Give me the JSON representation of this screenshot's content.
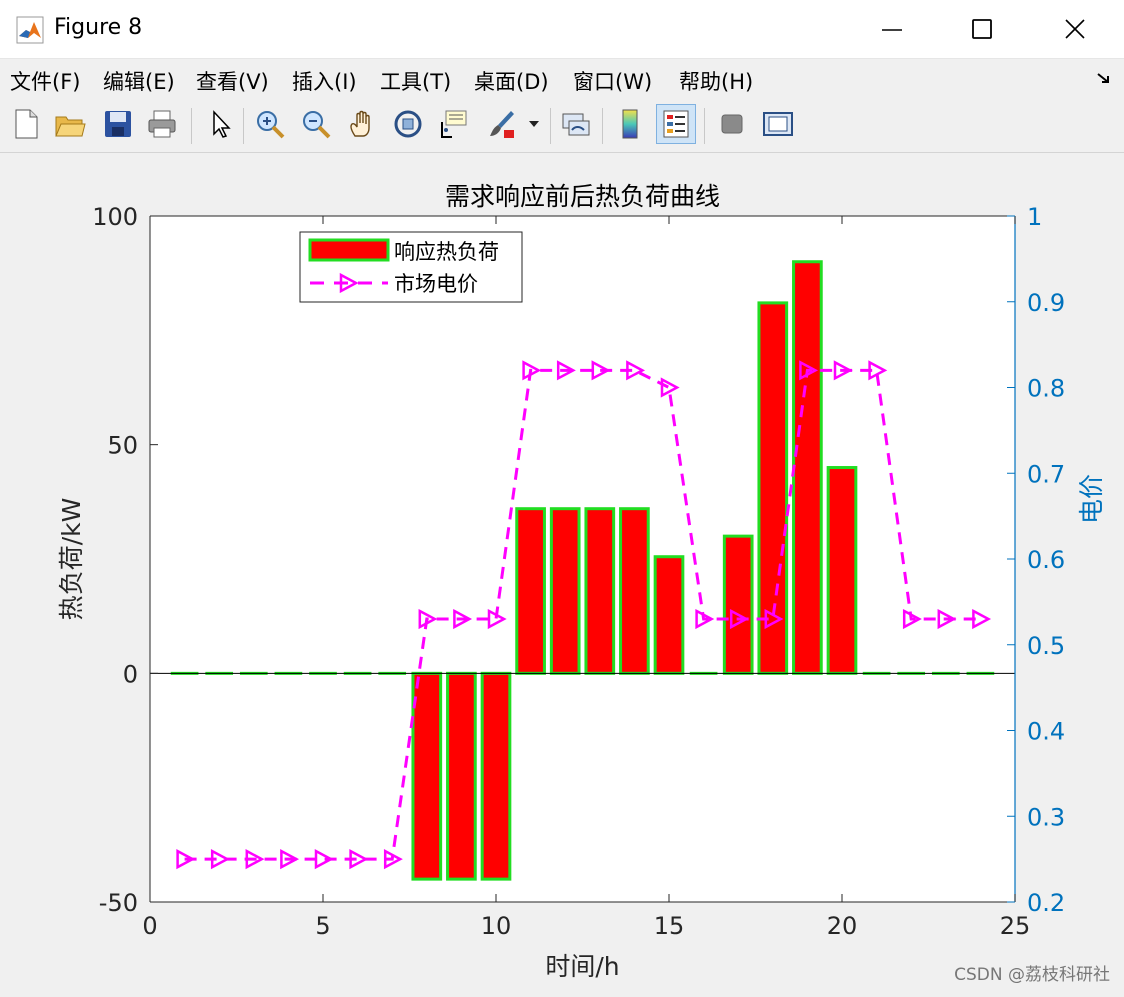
{
  "window": {
    "title": "Figure 8",
    "minimize_icon": "minimize-icon",
    "maximize_icon": "maximize-icon",
    "close_icon": "close-icon"
  },
  "menu": {
    "items": [
      "文件(F)",
      "编辑(E)",
      "查看(V)",
      "插入(I)",
      "工具(T)",
      "桌面(D)",
      "窗口(W)",
      "帮助(H)"
    ]
  },
  "toolbar": {
    "icons": [
      "new-figure-icon",
      "open-file-icon",
      "save-icon",
      "print-icon",
      "select-arrow-icon",
      "zoom-in-icon",
      "zoom-out-icon",
      "pan-hand-icon",
      "rotate-3d-icon",
      "data-cursor-icon",
      "brush-icon",
      "link-plot-icon",
      "colorbar-icon",
      "legend-icon",
      "hide-plot-tools-icon",
      "show-plot-tools-icon"
    ]
  },
  "watermark": "CSDN @荔枝科研社",
  "colors": {
    "bar_fill": "#ff0000",
    "bar_edge": "#22dd22",
    "price_line": "#ff00ff",
    "right_axis": "#0072bd"
  },
  "chart_data": {
    "type": "bar",
    "title": "需求响应前后热负荷曲线",
    "xlabel": "时间/h",
    "ylabel_left": "热负荷/kW",
    "ylabel_right": "电价",
    "xlim": [
      0,
      25
    ],
    "ylim_left": [
      -50,
      100
    ],
    "ylim_right": [
      0.2,
      1.0
    ],
    "xticks": [
      0,
      5,
      10,
      15,
      20,
      25
    ],
    "yticks_left": [
      -50,
      0,
      50,
      100
    ],
    "yticks_right": [
      0.2,
      0.3,
      0.4,
      0.5,
      0.6,
      0.7,
      0.8,
      0.9,
      1
    ],
    "legend_position": "top-left",
    "series": [
      {
        "name": "响应热负荷",
        "kind": "bar",
        "axis": "left",
        "x": [
          1,
          2,
          3,
          4,
          5,
          6,
          7,
          8,
          9,
          10,
          11,
          12,
          13,
          14,
          15,
          16,
          17,
          18,
          19,
          20,
          21,
          22,
          23,
          24
        ],
        "values": [
          0,
          0,
          0,
          0,
          0,
          0,
          0,
          -45,
          -45,
          -45,
          36,
          36,
          36,
          36,
          25.5,
          0,
          30,
          81,
          90,
          45,
          0,
          0,
          0,
          0
        ]
      },
      {
        "name": "市场电价",
        "kind": "line",
        "axis": "right",
        "x": [
          1,
          2,
          3,
          4,
          5,
          6,
          7,
          8,
          9,
          10,
          11,
          12,
          13,
          14,
          15,
          16,
          17,
          18,
          19,
          20,
          21,
          22,
          23,
          24
        ],
        "values": [
          0.25,
          0.25,
          0.25,
          0.25,
          0.25,
          0.25,
          0.25,
          0.53,
          0.53,
          0.53,
          0.82,
          0.82,
          0.82,
          0.82,
          0.8,
          0.53,
          0.53,
          0.53,
          0.82,
          0.82,
          0.82,
          0.53,
          0.53,
          0.53
        ]
      }
    ]
  }
}
